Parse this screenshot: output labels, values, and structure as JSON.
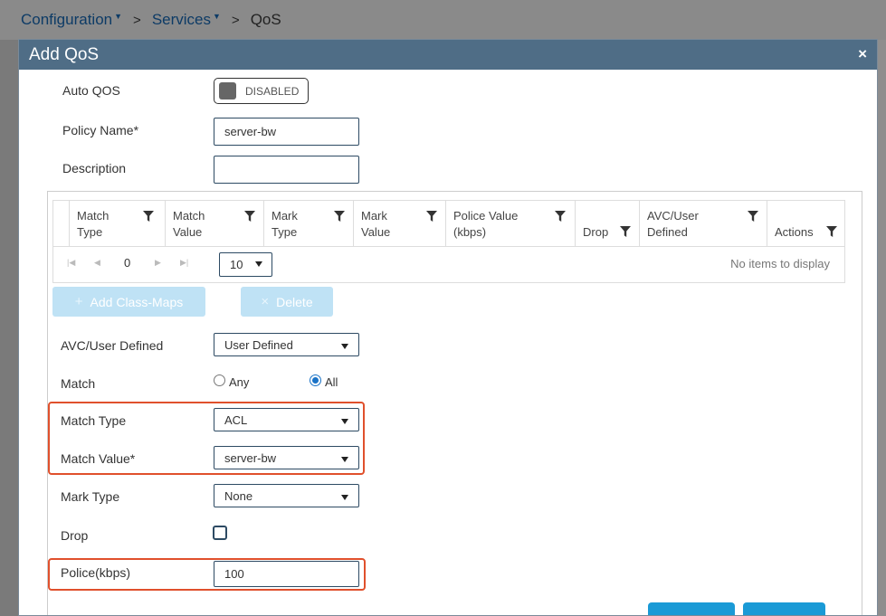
{
  "breadcrumb": {
    "items": [
      {
        "label": "Configuration",
        "dropdown": true
      },
      {
        "label": "Services",
        "dropdown": true
      }
    ],
    "current": "QoS"
  },
  "modal": {
    "title": "Add QoS",
    "close_icon": "×"
  },
  "form": {
    "auto_qos_label": "Auto QOS",
    "auto_qos_state": "DISABLED",
    "policy_name_label": "Policy Name*",
    "policy_name_value": "server-bw",
    "description_label": "Description",
    "description_value": "",
    "avc_label": "AVC/User Defined",
    "avc_value": "User Defined",
    "match_label": "Match",
    "match_options": [
      "Any",
      "All"
    ],
    "match_selected": "All",
    "match_type_label": "Match Type",
    "match_type_value": "ACL",
    "match_value_label": "Match Value*",
    "match_value_value": "server-bw",
    "mark_type_label": "Mark Type",
    "mark_type_value": "None",
    "drop_label": "Drop",
    "drop_checked": false,
    "police_label": "Police(kbps)",
    "police_value": "100"
  },
  "grid": {
    "columns": [
      {
        "l1": "Match",
        "l2": "Type"
      },
      {
        "l1": "Match",
        "l2": "Value"
      },
      {
        "l1": "Mark",
        "l2": "Type"
      },
      {
        "l1": "Mark",
        "l2": "Value"
      },
      {
        "l1": "Police Value",
        "l2": "(kbps)"
      },
      {
        "l1": "",
        "l2": "Drop"
      },
      {
        "l1": "AVC/User",
        "l2": "Defined"
      },
      {
        "l1": "",
        "l2": "Actions"
      }
    ],
    "page": "0",
    "page_size": "10",
    "empty_text": "No items to display"
  },
  "buttons": {
    "add_class_maps": "Add Class-Maps",
    "delete": "Delete"
  },
  "colors": {
    "header_bg": "#4f6d86",
    "highlight": "#e0502c",
    "disabled_button": "#bfe2f5",
    "primary": "#1a9ad6"
  }
}
